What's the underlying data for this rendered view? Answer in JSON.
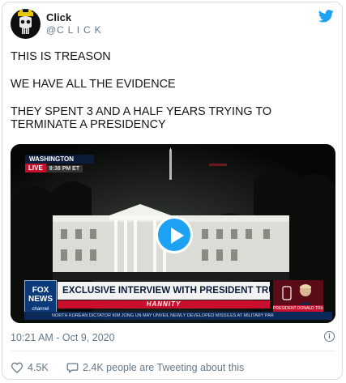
{
  "tweet": {
    "display_name": "Click",
    "handle": "@C L I C K",
    "text_lines": [
      "THIS IS TREASON",
      "WE HAVE ALL THE EVIDENCE",
      "THEY SPENT 3 AND A HALF YEARS TRYING TO",
      "TERMINATE A PRESIDENCY"
    ],
    "timestamp": "10:21 AM - Oct 9, 2020",
    "likes": "4.5K",
    "tweeting_about": "2.4K people are Tweeting about this"
  },
  "video": {
    "location_label": "WASHINGTON",
    "live_label": "LIVE",
    "time_label": "9:38 PM ET",
    "network_logo": "FOX NEWS channel",
    "headline": "EXCLUSIVE INTERVIEW WITH PRESIDENT TRUMP",
    "show_name": "HANNITY",
    "ticker": "NORTH KOREAN DICTATOR KIM JONG UN MAY UNVEIL NEWLY DEVELOPED MISSILES AT MILITARY PAR",
    "pip_caption": "PRESIDENT DONALD TRUMP"
  },
  "colors": {
    "twitter_blue": "#1da1f2",
    "text": "#14171a",
    "secondary": "#657786",
    "fox_red": "#c8102e",
    "fox_navy": "#0b1c3a"
  },
  "icons": [
    "twitter-bird-icon",
    "play-icon",
    "heart-icon",
    "comment-icon",
    "info-icon"
  ]
}
